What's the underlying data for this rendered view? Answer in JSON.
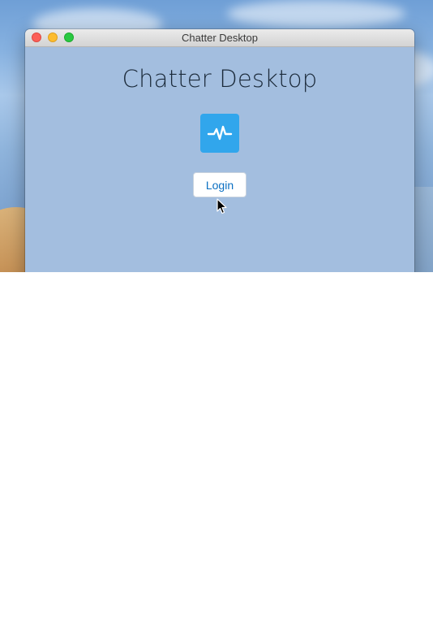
{
  "window": {
    "title": "Chatter Desktop"
  },
  "main": {
    "heading": "Chatter Desktop",
    "logo_icon": "activity-pulse-icon",
    "login_label": "Login"
  },
  "colors": {
    "window_background": "#a3bedf",
    "logo_background": "#31a6ec",
    "login_text": "#0a6fc2",
    "close": "#fc5f57",
    "minimize": "#fdbc2e",
    "maximize": "#29c941"
  }
}
